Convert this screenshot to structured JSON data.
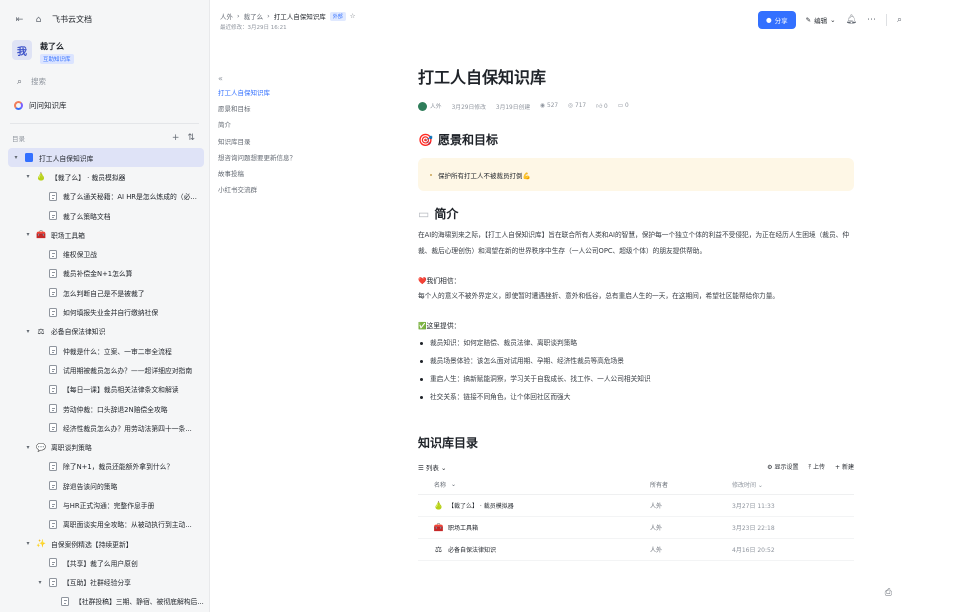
{
  "sidebar": {
    "brand": "飞书云文档",
    "workspace": {
      "avatar_text": "我",
      "name": "裁了么",
      "tag": "互助知识库"
    },
    "search_placeholder": "搜索",
    "qa_label": "问问知识库",
    "directory_label": "目录",
    "tree": [
      {
        "label": "打工人自保知识库",
        "level": 0,
        "toggle": "▾",
        "icon": "kb",
        "active": true
      },
      {
        "label": "【裁了么】 · 裁员模拟器",
        "level": 1,
        "toggle": "▾",
        "icon": "🍐"
      },
      {
        "label": "裁了么通关秘籍：AI HR是怎么炼成的（必...",
        "level": 2,
        "toggle": "",
        "icon": "doc"
      },
      {
        "label": "裁了么策略文档",
        "level": 2,
        "toggle": "",
        "icon": "doc"
      },
      {
        "label": "职场工具箱",
        "level": 1,
        "toggle": "▾",
        "icon": "🧰"
      },
      {
        "label": "维权保卫战",
        "level": 2,
        "toggle": "",
        "icon": "doc"
      },
      {
        "label": "裁员补偿金N+1怎么算",
        "level": 2,
        "toggle": "",
        "icon": "doc"
      },
      {
        "label": "怎么判断自己是不是被裁了",
        "level": 2,
        "toggle": "",
        "icon": "doc"
      },
      {
        "label": "如何填报失业金并自行缴纳社保",
        "level": 2,
        "toggle": "",
        "icon": "doc"
      },
      {
        "label": "必备自保法律知识",
        "level": 1,
        "toggle": "▾",
        "icon": "⚖"
      },
      {
        "label": "仲裁是什么：立案、一审二审全流程",
        "level": 2,
        "toggle": "",
        "icon": "doc"
      },
      {
        "label": "试用期被裁员怎么办？——超详细应对指南",
        "level": 2,
        "toggle": "",
        "icon": "doc"
      },
      {
        "label": "【每日一课】裁员相关法律条文和解读",
        "level": 2,
        "toggle": "",
        "icon": "doc"
      },
      {
        "label": "劳动仲裁：口头辞退2N赔偿全攻略",
        "level": 2,
        "toggle": "",
        "icon": "doc"
      },
      {
        "label": "经济性裁员怎么办？用劳动法第四十一条...",
        "level": 2,
        "toggle": "",
        "icon": "doc"
      },
      {
        "label": "离职谈判策略",
        "level": 1,
        "toggle": "▾",
        "icon": "💬"
      },
      {
        "label": "除了N+1，裁员还能额外拿到什么？",
        "level": 2,
        "toggle": "",
        "icon": "doc"
      },
      {
        "label": "辞退告该问的策略",
        "level": 2,
        "toggle": "",
        "icon": "doc"
      },
      {
        "label": "与HR正式沟通：完整作息手册",
        "level": 2,
        "toggle": "",
        "icon": "doc"
      },
      {
        "label": "离职面谈实用全攻略：从被动执行到主动...",
        "level": 2,
        "toggle": "",
        "icon": "doc"
      },
      {
        "label": "自保案例精选【持续更新】",
        "level": 1,
        "toggle": "▾",
        "icon": "✨"
      },
      {
        "label": "【共享】裁了么用户原创",
        "level": 2,
        "toggle": "",
        "icon": "doc"
      },
      {
        "label": "【互助】社群经验分享",
        "level": 2,
        "toggle": "▾",
        "icon": "doc"
      },
      {
        "label": "【社群投稿】三期、静宿、被彻底解构后...",
        "level": 3,
        "toggle": "",
        "icon": "doc"
      }
    ]
  },
  "topbar": {
    "breadcrumbs": [
      "人外",
      "裁了么",
      "打工人自保知识库"
    ],
    "tag": "外部",
    "edited": "最近修改：3月29日 16:21",
    "share_label": "分享",
    "edit_label": "编辑"
  },
  "outline": {
    "items": [
      "打工人自保知识库",
      "愿景和目标",
      "简介",
      "知识库目录",
      "想咨询问题想要更新信息？",
      "故事投稿",
      "小红书交流群"
    ],
    "active_index": 0
  },
  "doc": {
    "title": "打工人自保知识库",
    "meta": {
      "author": "人外",
      "modified": "3月29日修改",
      "created": "3月19日创建",
      "views": "527",
      "readers": "717",
      "likes": "0",
      "comments": "0"
    },
    "vision_heading": "愿景和目标",
    "callout": "保护所有打工人不被裁员打倒💪",
    "intro_heading": "简介",
    "intro_para": "在AI的海啸到来之际，【打工人自保知识库】旨在联合所有人类和AI的智慧，保护每一个独立个体的利益不受侵犯，为正在经历人生困境（裁员、仲裁、裁后心理创伤）和渴望在新的世界秩序中生存（一人公司OPC、超级个体）的朋友提供帮助。",
    "belief_heading": "❤️我们相信：",
    "belief_para": "每个人的意义不被外界定义，即使暂时遭遇挫折、意外和低谷，总有重启人生的一天，在这期间，希望社区能帮给你力量。",
    "offer_heading": "✅这里提供：",
    "offers": [
      "裁员知识：如何定赔偿、裁员法律、离职谈判策略",
      "裁员场景体验：该怎么面对试用期、孕期、经济性裁员等高危场景",
      "重启人生：搞新赋能洞察，学习关于自我成长、找工作、一人公司相关知识",
      "社交关系：链接不同角色，让个体回社区而强大"
    ],
    "catalog_heading": "知识库目录",
    "catalog": {
      "view_label": "列表",
      "actions": [
        "显示设置",
        "上传",
        "新建"
      ],
      "columns": [
        "名称",
        "所有者",
        "修改时间"
      ],
      "rows": [
        {
          "icon": "🍐",
          "name": "【裁了么】 · 裁员模拟器",
          "owner": "人外",
          "time": "3月27日 11:33"
        },
        {
          "icon": "🧰",
          "name": "职场工具箱",
          "owner": "人外",
          "time": "3月23日 22:18"
        },
        {
          "icon": "⚖",
          "name": "必备自保法律知识",
          "owner": "人外",
          "time": "4月16日 20:52"
        }
      ]
    }
  }
}
